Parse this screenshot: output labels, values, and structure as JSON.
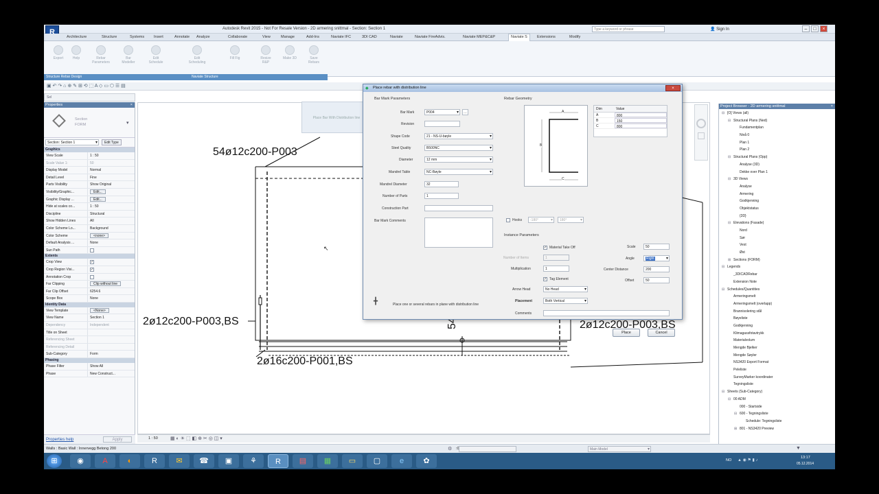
{
  "app": {
    "title": "Autodesk Revit 2015 - Not For Resale Version - 2D armering snittmal - Section: Section 1",
    "search_placeholder": "Type a keyword or phrase",
    "sign_in": "Sign In",
    "logo": "R"
  },
  "ribbon": {
    "tabs": [
      "Architecture",
      "Structure",
      "Systems",
      "Insert",
      "Annotate",
      "Analyze",
      "Collaborate",
      "View",
      "Manage",
      "Add-Ins",
      "Naviate IFC",
      "3DI CAD",
      "Naviate",
      "Naviate FireAdvis.",
      "Naviate MEP&C&P",
      "Naviate S",
      "Extensions",
      "Modify"
    ],
    "active_tab": "Naviate S",
    "buttons": [
      "Export",
      "Help",
      "Rebar Parameters",
      "Bar Modeller",
      "Edit Schedule",
      "Edit Scheduling",
      "Fill Fig",
      "Resize R&P",
      "Make 3D",
      "Save Rebars"
    ],
    "panel_labels": [
      "Structure Rebar Design",
      "Naviate Structure"
    ]
  },
  "properties": {
    "header": "Properties",
    "type_name": "Section",
    "type_sub": "FORM",
    "selector": "Section: Section 1",
    "edit_type": "Edit Type",
    "groups": [
      {
        "name": "Graphics",
        "rows": [
          [
            "View Scale",
            "1 : 50",
            ""
          ],
          [
            "Scale Value    1:",
            "50",
            "dim"
          ],
          [
            "Display Model",
            "Normal",
            ""
          ],
          [
            "Detail Level",
            "Fine",
            ""
          ],
          [
            "Parts Visibility",
            "Show Original",
            ""
          ],
          [
            "Visibility/Graphic...",
            "Edit...",
            "btn"
          ],
          [
            "Graphic Display ...",
            "Edit...",
            "btn"
          ],
          [
            "Hide at scales co...",
            "1 : 50",
            ""
          ],
          [
            "Discipline",
            "Structural",
            ""
          ],
          [
            "Show Hidden Lines",
            "All",
            ""
          ],
          [
            "Color Scheme Lo...",
            "Background",
            ""
          ],
          [
            "Color Scheme",
            "<none>",
            "btn"
          ],
          [
            "Default Analysis ...",
            "None",
            ""
          ],
          [
            "Sun Path",
            "",
            "chk"
          ]
        ]
      },
      {
        "name": "Extents",
        "rows": [
          [
            "Crop View",
            "✓",
            "chk"
          ],
          [
            "Crop Region Visi...",
            "✓",
            "chk"
          ],
          [
            "Annotation Crop",
            "",
            "chk"
          ],
          [
            "Far Clipping",
            "Clip without line",
            "btn"
          ],
          [
            "Far Clip Offset",
            "6254.6",
            ""
          ],
          [
            "Scope Box",
            "None",
            ""
          ]
        ]
      },
      {
        "name": "Identity Data",
        "rows": [
          [
            "View Template",
            "<None>",
            "btn"
          ],
          [
            "View Name",
            "Section 1",
            ""
          ],
          [
            "Dependency",
            "Independent",
            "dim"
          ],
          [
            "Title on Sheet",
            "",
            ""
          ],
          [
            "Referencing Sheet",
            "",
            "dim"
          ],
          [
            "Referencing Detail",
            "",
            "dim"
          ],
          [
            "Sub-Category",
            "Form",
            ""
          ]
        ]
      },
      {
        "name": "Phasing",
        "rows": [
          [
            "Phase Filter",
            "Show All",
            ""
          ],
          [
            "Phase",
            "New Construct...",
            ""
          ]
        ]
      }
    ],
    "help_link": "Properties help",
    "apply": "Apply"
  },
  "drawing": {
    "labels": [
      "54ø12c200-P003",
      "2ø12c200-P003,BS",
      "2ø16c200-P001,BS",
      "2ø12c200-P003,BS",
      "54ø"
    ],
    "scale": "1 : 50",
    "model": "Main Model",
    "ghost_button": "Place Bar With Distribution line"
  },
  "dialog": {
    "title": "Place rebar with distribution line",
    "bar_mark_params": "Bar Mark Parameters",
    "bar_mark_label": "Bar Mark",
    "bar_mark_value": "P004",
    "revision_label": "Revision",
    "shape_code_label": "Shape Code",
    "shape_code_value": "21 - NS-U-bøyle",
    "steel_quality_label": "Steel Quality",
    "steel_quality_value": "B500NC",
    "diameter_label": "Diameter",
    "diameter_value": "12 mm",
    "mandrel_table_label": "Mandrel Table",
    "mandrel_table_value": "NC-Bøyle",
    "mandrel_diameter_label": "Mandrel Diameter",
    "mandrel_diameter_value": "32",
    "number_of_parts_label": "Number of Parts",
    "number_of_parts_value": "1",
    "construction_part_label": "Construction Part",
    "comments_label": "Bar Mark Comments",
    "rebar_geometry": "Rebar Geometry",
    "geometry_letters": [
      "A",
      "B",
      "C"
    ],
    "dim_header": "Dim",
    "value_header": "Value",
    "dims": [
      [
        "A",
        "800"
      ],
      [
        "B",
        "150"
      ],
      [
        "C",
        "800"
      ]
    ],
    "hooks_label": "Hooks",
    "hook1": "-180°",
    "hook2": "180°",
    "instance_params": "Instance Parameters",
    "material_takeoff": "Material Take Off",
    "number_of_items_label": "Number of Items",
    "number_of_items_value": "1",
    "multiplication_label": "Multiplication",
    "multiplication_value": "1",
    "tag_element": "Tag Element",
    "arrow_head_label": "Arrow Head",
    "arrow_head_value": "No Head",
    "placement_label": "Placement",
    "placement_value": "Both Vertical",
    "comments2_label": "Comments",
    "scale_label": "Scale",
    "scale_value": "50",
    "angle_label": "Angle",
    "angle_value": "Right",
    "center_distance_label": "Center Distance",
    "center_distance_value": "200",
    "offset_label": "Offset",
    "offset_value": "50",
    "hint": "Place one or several rebars in plane with distribution line",
    "place": "Place",
    "cancel": "Cancel"
  },
  "browser": {
    "header": "Project Browser - 2D armering snittmal",
    "items": [
      [
        "0",
        "⊟",
        "[O] Views (all)"
      ],
      [
        "1",
        "⊟",
        "Structural Plans (Ned)"
      ],
      [
        "2",
        "",
        "Fundamentplan"
      ],
      [
        "2",
        "",
        "Nivå 0"
      ],
      [
        "2",
        "",
        "Plan 1"
      ],
      [
        "2",
        "",
        "Plan 2"
      ],
      [
        "1",
        "⊟",
        "Structural Plans (Opp)"
      ],
      [
        "2",
        "",
        "Analyse (3D)"
      ],
      [
        "2",
        "",
        "Dekke over Plan 1"
      ],
      [
        "1",
        "⊟",
        "3D Views"
      ],
      [
        "2",
        "",
        "Analyse"
      ],
      [
        "2",
        "",
        "Armering"
      ],
      [
        "2",
        "",
        "Godkjenning"
      ],
      [
        "2",
        "",
        "Objektstatus"
      ],
      [
        "2",
        "",
        "{3D}"
      ],
      [
        "1",
        "⊟",
        "Elevations (Fasade)"
      ],
      [
        "2",
        "",
        "Nord"
      ],
      [
        "2",
        "",
        "Sør"
      ],
      [
        "2",
        "",
        "Vest"
      ],
      [
        "2",
        "",
        "Øst"
      ],
      [
        "1",
        "⊞",
        "Sections (FORM)"
      ],
      [
        "0",
        "⊟",
        "Legends"
      ],
      [
        "1",
        "",
        "_3DICADRebar"
      ],
      [
        "1",
        "",
        "Extension Note"
      ],
      [
        "0",
        "⊟",
        "Schedules/Quantities"
      ],
      [
        "1",
        "",
        "Armeringsmelt"
      ],
      [
        "1",
        "",
        "Armeringsmelt (overlapp)"
      ],
      [
        "1",
        "",
        "Brannisolering stål"
      ],
      [
        "1",
        "",
        "Bøyeliste"
      ],
      [
        "1",
        "",
        "Godkjenning"
      ],
      [
        "1",
        "",
        "Klimagassfotavtrykk"
      ],
      [
        "1",
        "",
        "Materialvolum"
      ],
      [
        "1",
        "",
        "Mengde Bjelker"
      ],
      [
        "1",
        "",
        "Mengde Søyler"
      ],
      [
        "1",
        "",
        "NS3420 Export Format"
      ],
      [
        "1",
        "",
        "Peleliste"
      ],
      [
        "1",
        "",
        "SurveyMarker koordinater"
      ],
      [
        "1",
        "",
        "Tegningsliste"
      ],
      [
        "0",
        "⊟",
        "Sheets (Sub-Category)"
      ],
      [
        "1",
        "⊟",
        "00 ADM"
      ],
      [
        "2",
        "",
        "000 - Startside"
      ],
      [
        "2",
        "⊟",
        "600 - Tegningsliste"
      ],
      [
        "3",
        "",
        "Schedule: Tegningsliste"
      ],
      [
        "2",
        "⊞",
        "801 - NS3420 Preview"
      ]
    ]
  },
  "status": {
    "text": "Walls : Basic Wall : Innervegg Betong 200",
    "model": "Main Model",
    "zero": ":0"
  },
  "taskbar": {
    "time": "13:17",
    "date": "05.12.2014",
    "lang": "NO"
  }
}
